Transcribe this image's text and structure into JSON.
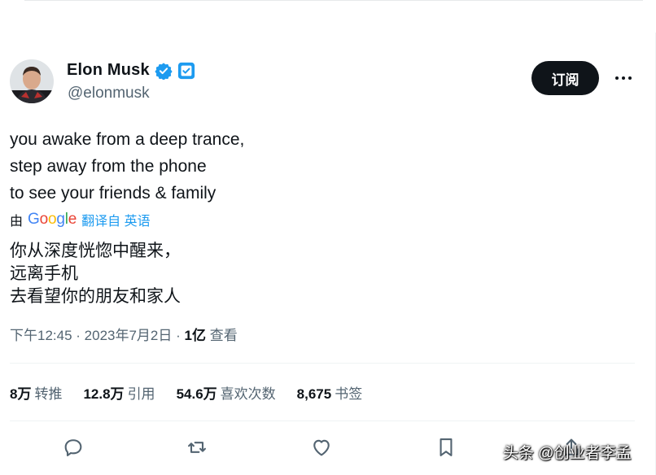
{
  "author": {
    "display_name": "Elon Musk",
    "handle": "@elonmusk",
    "verified_badge": "verified-check-icon",
    "affiliate_badge": "x-square-badge-icon"
  },
  "header": {
    "subscribe_label": "订阅",
    "more_icon": "more-horizontal-icon"
  },
  "tweet": {
    "lines": [
      "you awake from a deep trance,",
      "step away from the phone",
      "to see your friends & family"
    ],
    "translation": {
      "by_label": "由",
      "google_letters": [
        "G",
        "o",
        "o",
        "g",
        "l",
        "e"
      ],
      "link_label": "翻译自 英语",
      "lines": [
        "你从深度恍惚中醒来，",
        "远离手机",
        "去看望你的朋友和家人"
      ]
    },
    "meta": {
      "time": "下午12:45",
      "separator": " · ",
      "date": "2023年7月2日",
      "views_count": "1亿",
      "views_label": "查看"
    }
  },
  "stats": [
    {
      "count": "8万",
      "label": "转推"
    },
    {
      "count": "12.8万",
      "label": "引用"
    },
    {
      "count": "54.6万",
      "label": "喜欢次数"
    },
    {
      "count": "8,675",
      "label": "书签"
    }
  ],
  "actions": [
    "reply-icon",
    "retweet-icon",
    "like-icon",
    "bookmark-icon",
    "share-icon"
  ],
  "watermark": "头条 @创业者李孟",
  "colors": {
    "accent": "#1d9bf0",
    "text_primary": "#0f1419",
    "text_secondary": "#536471",
    "button_bg": "#0f1419"
  }
}
